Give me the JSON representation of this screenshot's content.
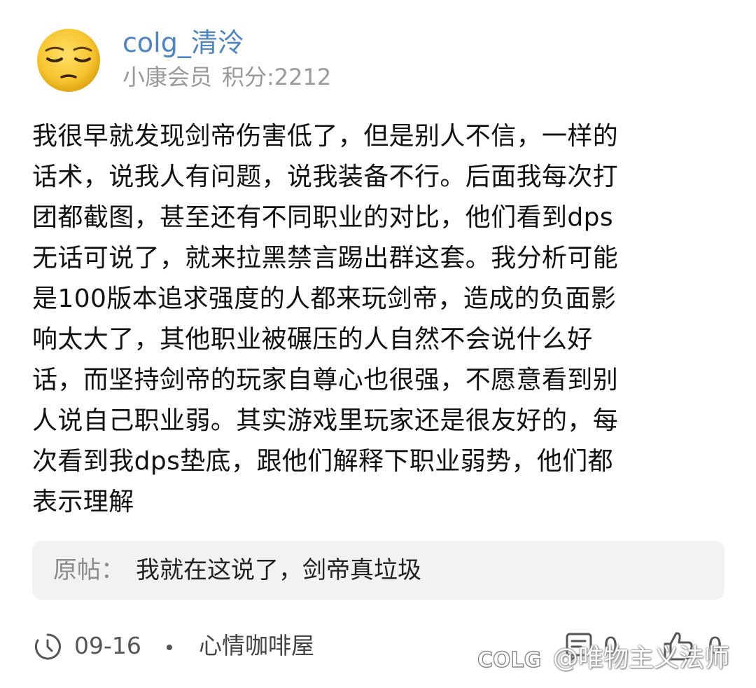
{
  "post": {
    "author": {
      "name": "colg_清泠",
      "rank": "小康会员",
      "points": "积分:2212",
      "avatar_icon": "sad-face-emoji-icon"
    },
    "body_lines": [
      "我很早就发现剑帝伤害低了，但是别人不信，一样的",
      "话术，说我人有问题，说我装备不行。后面我每次打",
      "团都截图，甚至还有不同职业的对比，他们看到dps",
      "无话可说了，就来拉黑禁言踢出群这套。我分析可能",
      "是100版本追求强度的人都来玩剑帝，造成的负面影",
      "响太大了，其他职业被碾压的人自然不会说什么好",
      "话，而坚持剑帝的玩家自尊心也很强，不愿意看到别",
      "人说自己职业弱。其实游戏里玩家还是很友好的，每",
      "次看到我dps垫底，跟他们解释下职业弱势，他们都",
      "表示理解"
    ],
    "quote": {
      "label": "原帖：",
      "text": "我就在这说了，剑帝真垃圾"
    },
    "footer": {
      "clock_icon": "clock-icon",
      "date": "09-16",
      "board": "心情咖啡屋",
      "comment_icon": "comment-icon",
      "comment_count": "0",
      "like_icon": "thumbs-up-icon",
      "like_count": "0"
    }
  },
  "watermark": {
    "logo": "COLG",
    "text": "@唯物主义法师"
  },
  "colors": {
    "username": "#4f84c4",
    "meta": "#9a9a9a",
    "quote_bg": "#f2f2f2",
    "avatar_face": "#f7c531"
  }
}
